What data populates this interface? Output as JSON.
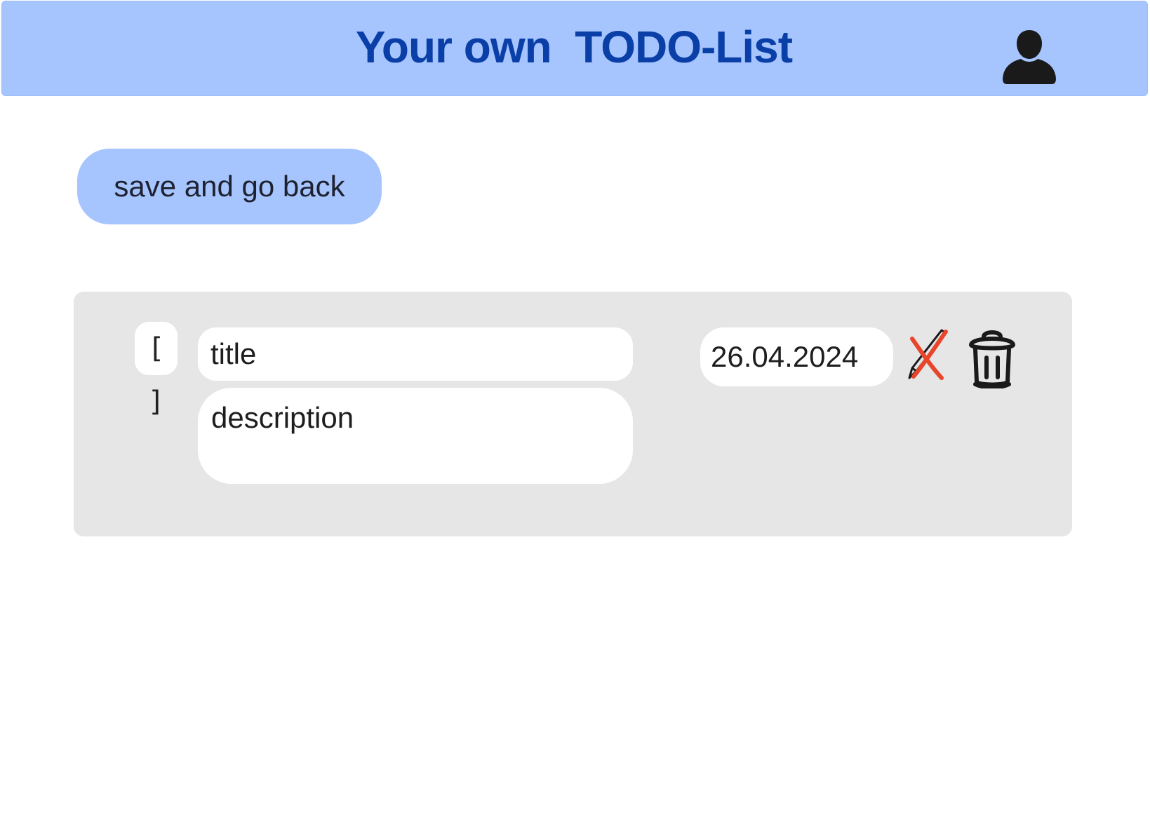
{
  "header": {
    "title": "Your own  TODO-List",
    "user_icon": "user-icon"
  },
  "actions": {
    "save_label": "save and go back"
  },
  "todo": {
    "checkbox_label": "[ ]",
    "title_placeholder": "title",
    "description_placeholder": "description",
    "date": "26.04.2024",
    "edit_icon": "edit-crossed-icon",
    "delete_icon": "trash-icon"
  },
  "colors": {
    "header_bg": "#a6c4fd",
    "title_color": "#0a3fa8",
    "button_bg": "#a6c4fd",
    "card_bg": "#e6e6e6",
    "edit_cross": "#e8452a"
  }
}
